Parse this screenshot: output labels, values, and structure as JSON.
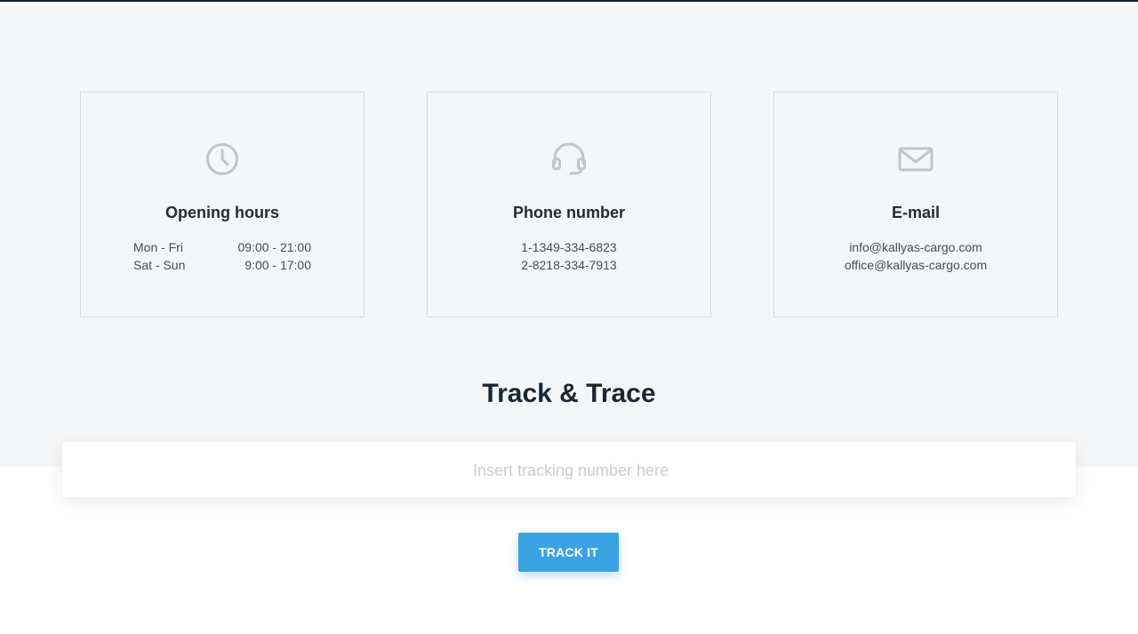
{
  "colors": {
    "accent": "#3aa4e3",
    "section_bg": "#f4f6f8",
    "icon": "#c2c5c8",
    "heading": "#1a2633"
  },
  "cards": [
    {
      "icon": "clock-icon",
      "title": "Opening hours",
      "rows": [
        {
          "day": "Mon - Fri",
          "time": "09:00 - 21:00"
        },
        {
          "day": "Sat - Sun",
          "time": "9:00 - 17:00"
        }
      ]
    },
    {
      "icon": "headset-icon",
      "title": "Phone number",
      "lines": [
        "1-1349-334-6823",
        "2-8218-334-7913"
      ]
    },
    {
      "icon": "envelope-icon",
      "title": "E-mail",
      "lines": [
        "info@kallyas-cargo.com",
        "office@kallyas-cargo.com"
      ]
    }
  ],
  "track": {
    "heading": "Track & Trace",
    "placeholder": "Insert tracking number here",
    "value": "",
    "button_label": "TRACK IT"
  }
}
